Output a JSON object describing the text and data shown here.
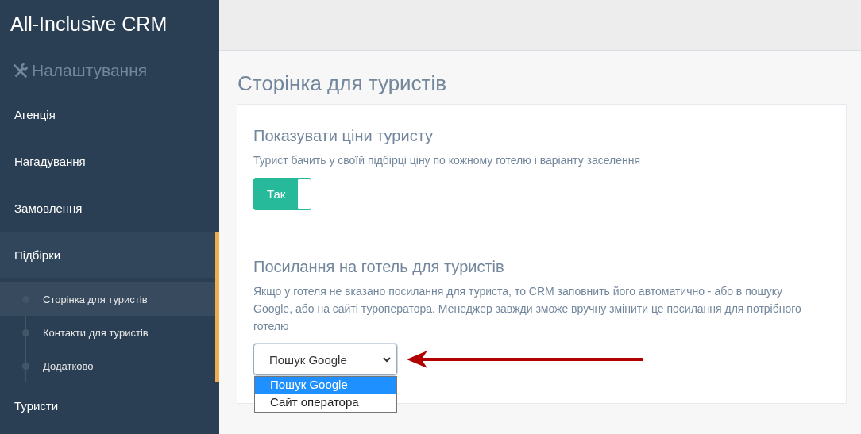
{
  "sidebar": {
    "logo": "All-Inclusive CRM",
    "section": "Налаштування",
    "items": [
      {
        "label": "Агенція",
        "selected": false
      },
      {
        "label": "Нагадування",
        "selected": false
      },
      {
        "label": "Замовлення",
        "selected": false
      },
      {
        "label": "Підбірки",
        "selected": true,
        "children": [
          {
            "label": "Сторінка для туристів",
            "selected": true
          },
          {
            "label": "Контакти для туристів",
            "selected": false
          },
          {
            "label": "Додатково",
            "selected": false
          }
        ]
      },
      {
        "label": "Туристи",
        "selected": false
      }
    ]
  },
  "page_title": "Сторінка для туристів",
  "sections": [
    {
      "kind": "toggle",
      "title": "Показувати ціни туристу",
      "description": "Турист бачить у своїй підбірці ціну по кожному готелю і варіанту заселення",
      "toggle": {
        "label": "Так",
        "on": true
      }
    },
    {
      "kind": "select",
      "title": "Посилання на готель для туристів",
      "description": "Якщо у готеля не вказано посилання для туриста, то CRM заповнить його автоматично - або в пошуку Google, або на сайті туроператора. Менеджер завжди зможе вручну змінити це посилання для потрібного готелю",
      "select": {
        "value": "Пошук Google",
        "expanded": true,
        "options": [
          {
            "label": "Пошук Google",
            "selected": true
          },
          {
            "label": "Сайт оператора",
            "selected": false
          }
        ]
      }
    }
  ]
}
